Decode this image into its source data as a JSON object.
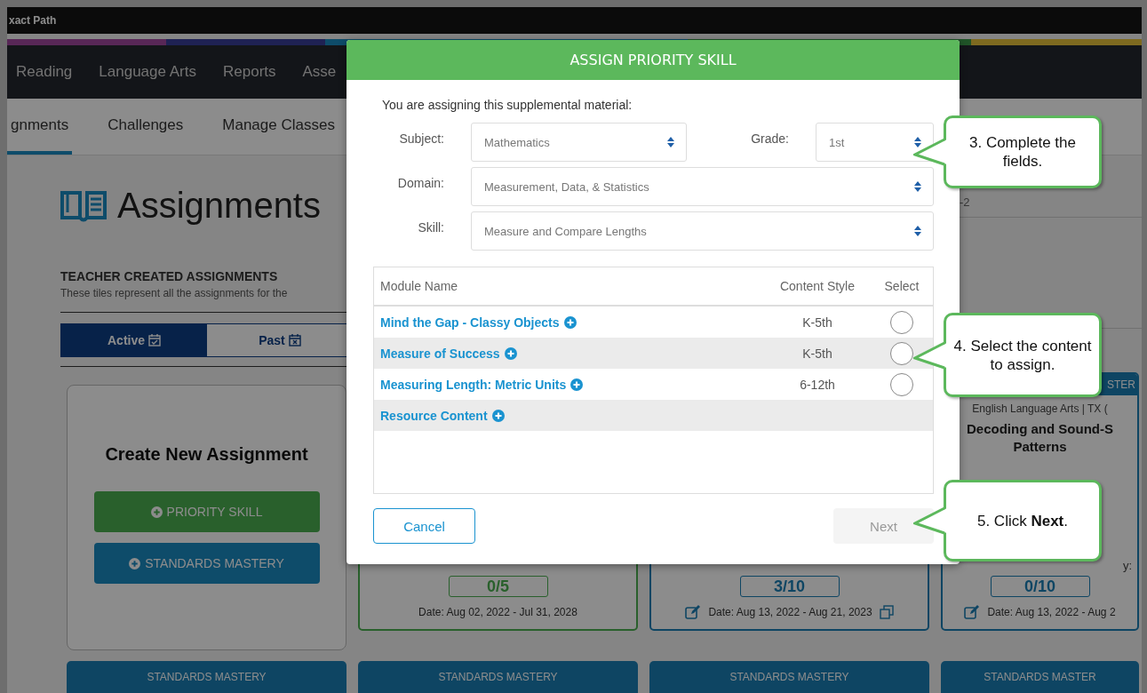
{
  "browser_bar": {
    "title": "xact Path"
  },
  "main_nav": [
    {
      "label": "Reading"
    },
    {
      "label": "Language Arts"
    },
    {
      "label": "Reports"
    },
    {
      "label": "Asse"
    }
  ],
  "sub_nav": [
    {
      "label": "gnments",
      "selected": true
    },
    {
      "label": "Challenges",
      "selected": false
    },
    {
      "label": "Manage Classes",
      "selected": false
    }
  ],
  "page": {
    "title": "Assignments",
    "section_title": "TEACHER CREATED ASSIGNMENTS",
    "section_description": "These tiles represent all the assignments for the",
    "filter_value": "-2",
    "tabs": [
      {
        "label": "Active",
        "selected": true
      },
      {
        "label": "Past",
        "selected": false
      }
    ],
    "create_tile": {
      "title": "Create New Assignment",
      "buttons": [
        {
          "label": "PRIORITY SKILL",
          "kind": "priority"
        },
        {
          "label": "STANDARDS MASTERY",
          "kind": "standards"
        }
      ]
    },
    "tiles": [
      {
        "kind": "priority",
        "count": "0/5",
        "date": "Date: Aug 02, 2022 - Jul 31, 2028",
        "editable": false,
        "copyable": false
      },
      {
        "kind": "standards",
        "count": "3/10",
        "date": "Date: Aug 13, 2022 - Aug 21, 2023",
        "editable": true,
        "copyable": true
      },
      {
        "kind": "standards",
        "header": "STER",
        "subject": "English Language Arts | TX (",
        "title": "Decoding and Sound-S Patterns",
        "label": "y:",
        "count": "0/10",
        "date": "Date: Aug 13, 2022 - Aug 2",
        "editable": true,
        "copyable": false
      }
    ],
    "bottom_headers": [
      "STANDARDS MASTERY",
      "STANDARDS MASTERY",
      "STANDARDS MASTERY",
      "STANDARDS MASTER"
    ]
  },
  "dialog": {
    "title": "ASSIGN PRIORITY SKILL",
    "intro": "You are assigning this supplemental material:",
    "fields": [
      {
        "label": "Subject:",
        "value": "Mathematics"
      },
      {
        "label": "Grade:",
        "value": "1st"
      },
      {
        "label": "Domain:",
        "value": "Measurement, Data, & Statistics"
      },
      {
        "label": "Skill:",
        "value": "Measure and Compare Lengths"
      }
    ],
    "table": {
      "columns": [
        "Module Name",
        "Content Style",
        "Select"
      ],
      "rows": [
        {
          "kind": "module",
          "name": "Mind the Gap - Classy Objects",
          "content_style": "K-5th",
          "selected": false
        },
        {
          "kind": "module",
          "name": "Measure of Success",
          "content_style": "K-5th",
          "selected": false
        },
        {
          "kind": "module",
          "name": "Measuring Length: Metric Units",
          "content_style": "6-12th",
          "selected": false
        },
        {
          "kind": "group",
          "name": "Resource Content"
        }
      ]
    },
    "buttons": [
      {
        "label": "Cancel"
      },
      {
        "label": "Next",
        "disabled": true
      }
    ]
  },
  "callouts": [
    {
      "text": "3. Complete the fields."
    },
    {
      "text": "4. Select the content to assign."
    },
    {
      "text": "5. Click **Next**."
    }
  ]
}
